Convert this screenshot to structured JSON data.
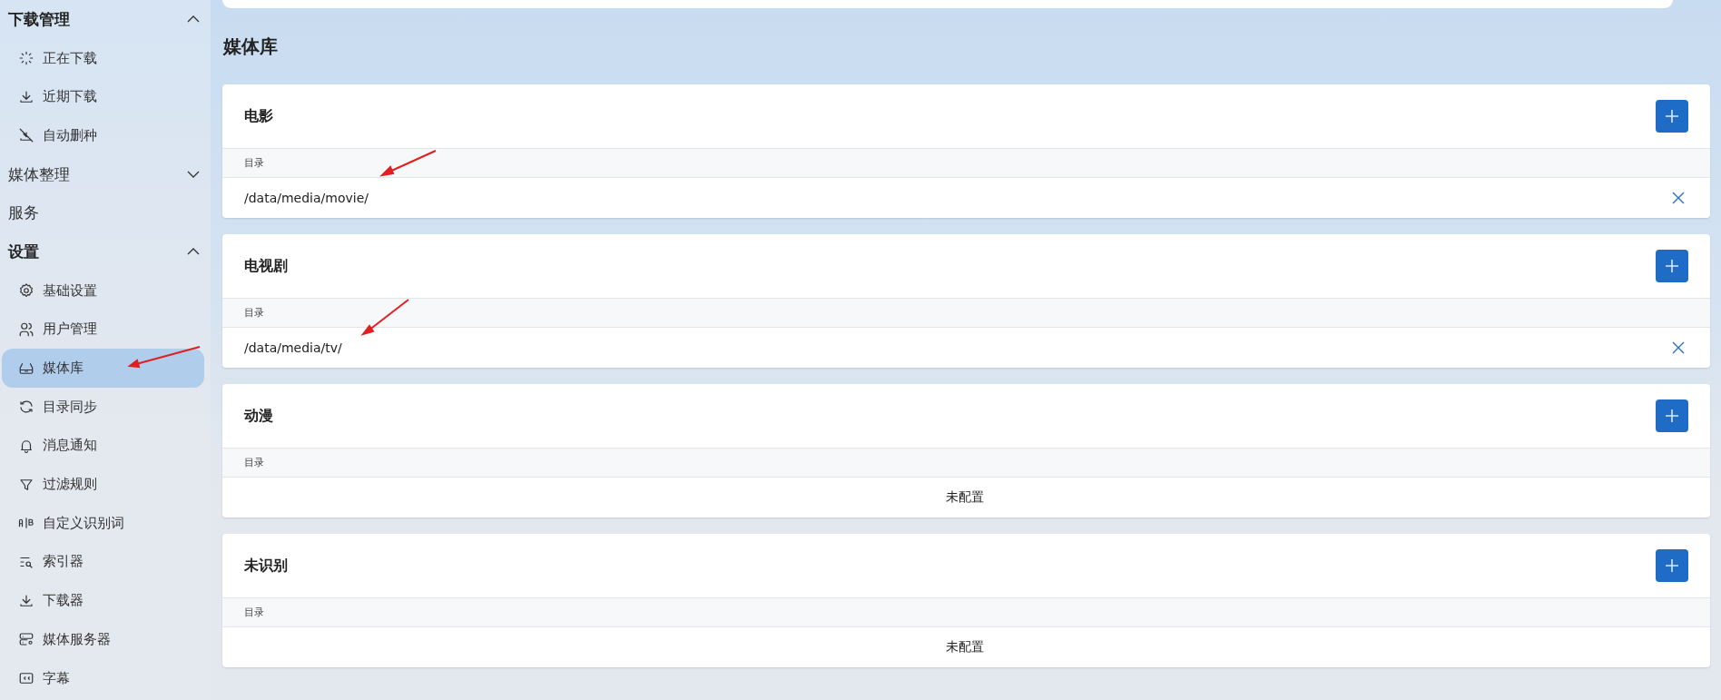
{
  "sidebar": [
    {
      "label": "下载管理",
      "kind": "group",
      "expanded": true,
      "children": [
        {
          "label": "正在下载",
          "selected": false
        },
        {
          "label": "近期下载",
          "selected": false
        },
        {
          "label": "自动删种",
          "selected": false
        }
      ]
    },
    {
      "label": "媒体整理",
      "kind": "group",
      "expanded": false
    },
    {
      "label": "服务",
      "kind": "link"
    },
    {
      "label": "设置",
      "kind": "group",
      "expanded": true,
      "children": [
        {
          "label": "基础设置",
          "selected": false
        },
        {
          "label": "用户管理",
          "selected": false
        },
        {
          "label": "媒体库",
          "selected": true
        },
        {
          "label": "目录同步",
          "selected": false
        },
        {
          "label": "消息通知",
          "selected": false
        },
        {
          "label": "过滤规则",
          "selected": false
        },
        {
          "label": "自定义识别词",
          "selected": false
        },
        {
          "label": "索引器",
          "selected": false
        },
        {
          "label": "下载器",
          "selected": false
        },
        {
          "label": "媒体服务器",
          "selected": false
        },
        {
          "label": "字幕",
          "selected": false
        }
      ]
    }
  ],
  "page_title": "媒体库",
  "libraries": [
    {
      "title": "电影",
      "column": "目录",
      "rows": [
        "/data/media/movie/"
      ]
    },
    {
      "title": "电视剧",
      "column": "目录",
      "rows": [
        "/data/media/tv/"
      ]
    },
    {
      "title": "动漫",
      "column": "目录",
      "empty_text": "未配置"
    },
    {
      "title": "未识别",
      "column": "目录",
      "empty_text": "未配置"
    }
  ]
}
